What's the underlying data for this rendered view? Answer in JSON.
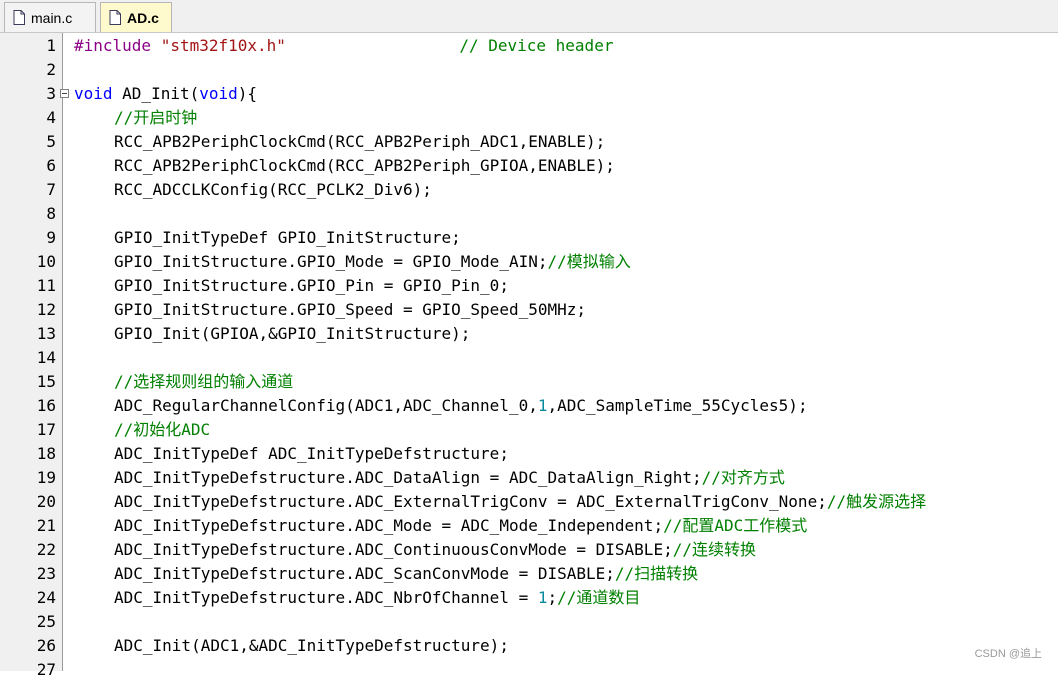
{
  "tabs": [
    {
      "label": "main.c",
      "active": false
    },
    {
      "label": "AD.c",
      "active": true
    }
  ],
  "editor": {
    "lines": [
      {
        "n": "1",
        "segs": [
          [
            "pp",
            "#include "
          ],
          [
            "str",
            "\"stm32f10x.h\""
          ],
          [
            "",
            "                  "
          ],
          [
            "cm",
            "// Device header"
          ]
        ]
      },
      {
        "n": "2",
        "segs": []
      },
      {
        "n": "3",
        "segs": [
          [
            "kw",
            "void"
          ],
          [
            "",
            " AD_Init("
          ],
          [
            "kw",
            "void"
          ],
          [
            "",
            "){"
          ]
        ]
      },
      {
        "n": "4",
        "ind": true,
        "segs": [
          [
            "cm",
            "//开启时钟"
          ]
        ]
      },
      {
        "n": "5",
        "ind": true,
        "segs": [
          [
            "",
            "RCC_APB2PeriphClockCmd(RCC_APB2Periph_ADC1,ENABLE);"
          ]
        ]
      },
      {
        "n": "6",
        "ind": true,
        "segs": [
          [
            "",
            "RCC_APB2PeriphClockCmd(RCC_APB2Periph_GPIOA,ENABLE);"
          ]
        ]
      },
      {
        "n": "7",
        "ind": true,
        "segs": [
          [
            "",
            "RCC_ADCCLKConfig(RCC_PCLK2_Div6);"
          ]
        ]
      },
      {
        "n": "8",
        "segs": []
      },
      {
        "n": "9",
        "ind": true,
        "segs": [
          [
            "",
            "GPIO_InitTypeDef GPIO_InitStructure;"
          ]
        ]
      },
      {
        "n": "10",
        "ind": true,
        "segs": [
          [
            "",
            "GPIO_InitStructure.GPIO_Mode = GPIO_Mode_AIN;"
          ],
          [
            "cm",
            "//模拟输入"
          ]
        ]
      },
      {
        "n": "11",
        "ind": true,
        "segs": [
          [
            "",
            "GPIO_InitStructure.GPIO_Pin = GPIO_Pin_0;"
          ]
        ]
      },
      {
        "n": "12",
        "ind": true,
        "segs": [
          [
            "",
            "GPIO_InitStructure.GPIO_Speed = GPIO_Speed_50MHz;"
          ]
        ]
      },
      {
        "n": "13",
        "ind": true,
        "segs": [
          [
            "",
            "GPIO_Init(GPIOA,&GPIO_InitStructure);"
          ]
        ]
      },
      {
        "n": "14",
        "segs": []
      },
      {
        "n": "15",
        "ind": true,
        "segs": [
          [
            "cm",
            "//选择规则组的输入通道"
          ]
        ]
      },
      {
        "n": "16",
        "ind": true,
        "segs": [
          [
            "",
            "ADC_RegularChannelConfig(ADC1,ADC_Channel_0,"
          ],
          [
            "num",
            "1"
          ],
          [
            "",
            ",ADC_SampleTime_55Cycles5);"
          ]
        ]
      },
      {
        "n": "17",
        "ind": true,
        "segs": [
          [
            "cm",
            "//初始化ADC"
          ]
        ]
      },
      {
        "n": "18",
        "ind": true,
        "segs": [
          [
            "",
            "ADC_InitTypeDef ADC_InitTypeDefstructure;"
          ]
        ]
      },
      {
        "n": "19",
        "ind": true,
        "segs": [
          [
            "",
            "ADC_InitTypeDefstructure.ADC_DataAlign = ADC_DataAlign_Right;"
          ],
          [
            "cm",
            "//对齐方式"
          ]
        ]
      },
      {
        "n": "20",
        "ind": true,
        "segs": [
          [
            "",
            "ADC_InitTypeDefstructure.ADC_ExternalTrigConv = ADC_ExternalTrigConv_None;"
          ],
          [
            "cm",
            "//触发源选择"
          ]
        ]
      },
      {
        "n": "21",
        "ind": true,
        "segs": [
          [
            "",
            "ADC_InitTypeDefstructure.ADC_Mode = ADC_Mode_Independent;"
          ],
          [
            "cm",
            "//配置ADC工作模式"
          ]
        ]
      },
      {
        "n": "22",
        "ind": true,
        "segs": [
          [
            "",
            "ADC_InitTypeDefstructure.ADC_ContinuousConvMode = DISABLE;"
          ],
          [
            "cm",
            "//连续转换"
          ]
        ]
      },
      {
        "n": "23",
        "ind": true,
        "segs": [
          [
            "",
            "ADC_InitTypeDefstructure.ADC_ScanConvMode = DISABLE;"
          ],
          [
            "cm",
            "//扫描转换"
          ]
        ]
      },
      {
        "n": "24",
        "ind": true,
        "segs": [
          [
            "",
            "ADC_InitTypeDefstructure.ADC_NbrOfChannel = "
          ],
          [
            "num",
            "1"
          ],
          [
            "",
            ";"
          ],
          [
            "cm",
            "//通道数目"
          ]
        ]
      },
      {
        "n": "25",
        "segs": []
      },
      {
        "n": "26",
        "ind": true,
        "segs": [
          [
            "",
            "ADC_Init(ADC1,&ADC_InitTypeDefstructure);"
          ]
        ]
      },
      {
        "n": "27",
        "segs": []
      }
    ]
  },
  "watermark": "CSDN @追上",
  "colors": {
    "keyword": "#0000ff",
    "comment": "#008000",
    "preprocessor": "#8b0086",
    "string": "#a31515",
    "number": "#098aa0",
    "active_tab_bg": "#fffacd"
  }
}
